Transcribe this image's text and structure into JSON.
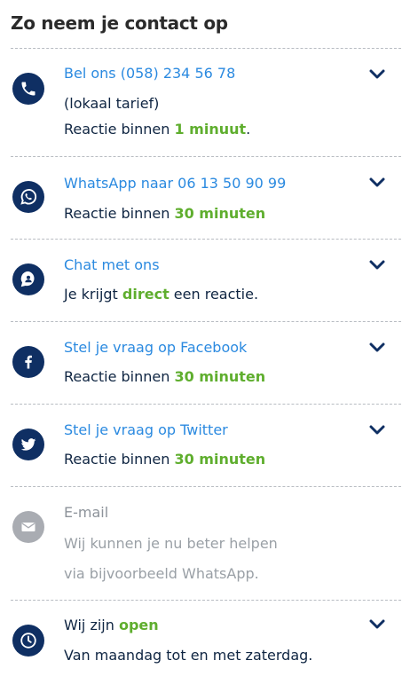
{
  "header": {
    "title": "Zo neem je contact op"
  },
  "phone": {
    "link": "Bel ons (058) 234 56 78",
    "note": "(lokaal tarief)",
    "reaction_prefix": "Reactie binnen ",
    "reaction_value": "1 minuut",
    "reaction_suffix": "."
  },
  "whatsapp": {
    "link": "WhatsApp naar 06 13 50 90 99",
    "reaction_prefix": "Reactie binnen ",
    "reaction_value": "30 minuten"
  },
  "chat": {
    "link": "Chat met ons",
    "reaction_prefix": "Je krijgt ",
    "reaction_value": "direct",
    "reaction_suffix": " een reactie."
  },
  "facebook": {
    "link": "Stel je vraag op Facebook",
    "reaction_prefix": "Reactie binnen ",
    "reaction_value": "30 minuten"
  },
  "twitter": {
    "link": "Stel je vraag op Twitter",
    "reaction_prefix": "Reactie binnen ",
    "reaction_value": "30 minuten"
  },
  "email": {
    "link": "E-mail",
    "line1": "Wij kunnen je nu beter helpen",
    "line2": "via bijvoorbeeld WhatsApp."
  },
  "hours": {
    "status_prefix": "Wij zijn ",
    "status_value": "open",
    "days": "Van maandag tot en met zaterdag."
  },
  "colors": {
    "link": "#2b8ae0",
    "icon_bg": "#0f2f63",
    "highlight": "#5fae2e",
    "text": "#0f2542",
    "disabled": "#a9acb2"
  }
}
